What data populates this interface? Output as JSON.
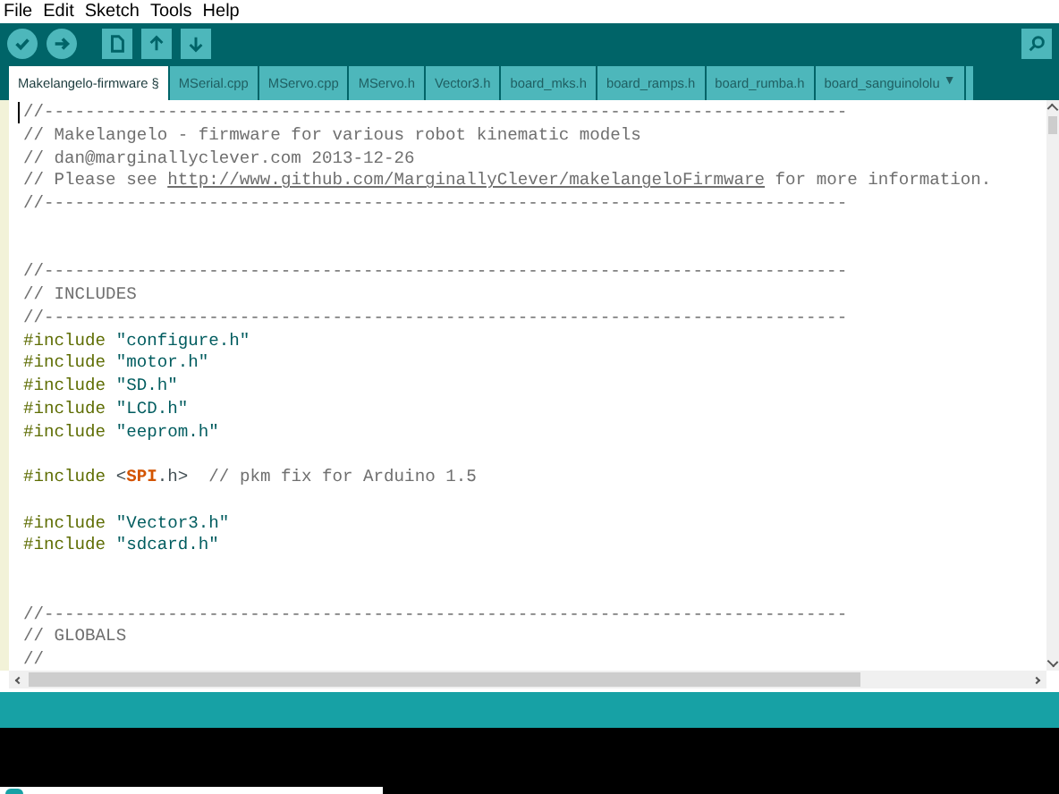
{
  "menu": [
    "File",
    "Edit",
    "Sketch",
    "Tools",
    "Help"
  ],
  "tabs": [
    {
      "label": "Makelangelo-firmware §",
      "selected": true
    },
    {
      "label": "MSerial.cpp",
      "selected": false
    },
    {
      "label": "MServo.cpp",
      "selected": false
    },
    {
      "label": "MServo.h",
      "selected": false
    },
    {
      "label": "Vector3.h",
      "selected": false
    },
    {
      "label": "board_mks.h",
      "selected": false
    },
    {
      "label": "board_ramps.h",
      "selected": false
    },
    {
      "label": "board_rumba.h",
      "selected": false
    },
    {
      "label": "board_sanguinololu",
      "selected": false,
      "menu": "▼"
    }
  ],
  "code": [
    {
      "kind": "comment",
      "text": "//------------------------------------------------------------------------------"
    },
    {
      "kind": "comment",
      "text": "// Makelangelo - firmware for various robot kinematic models"
    },
    {
      "kind": "comment",
      "text": "// dan@marginallyclever.com 2013-12-26"
    },
    {
      "kind": "link",
      "before": "// Please see ",
      "link": "http://www.github.com/MarginallyClever/makelangeloFirmware",
      "after": " for more information."
    },
    {
      "kind": "comment",
      "text": "//------------------------------------------------------------------------------"
    },
    {
      "kind": "blank"
    },
    {
      "kind": "blank"
    },
    {
      "kind": "comment",
      "text": "//------------------------------------------------------------------------------"
    },
    {
      "kind": "comment",
      "text": "// INCLUDES"
    },
    {
      "kind": "comment",
      "text": "//------------------------------------------------------------------------------"
    },
    {
      "kind": "include",
      "directive": "#include",
      "target": "\"configure.h\""
    },
    {
      "kind": "include",
      "directive": "#include",
      "target": "\"motor.h\""
    },
    {
      "kind": "include",
      "directive": "#include",
      "target": "\"SD.h\""
    },
    {
      "kind": "include",
      "directive": "#include",
      "target": "\"LCD.h\""
    },
    {
      "kind": "include",
      "directive": "#include",
      "target": "\"eeprom.h\""
    },
    {
      "kind": "blank"
    },
    {
      "kind": "library",
      "directive": "#include",
      "open": "<",
      "library": "SPI",
      "close": ".h>",
      "comment": "// pkm fix for Arduino 1.5"
    },
    {
      "kind": "blank"
    },
    {
      "kind": "include",
      "directive": "#include",
      "target": "\"Vector3.h\""
    },
    {
      "kind": "include",
      "directive": "#include",
      "target": "\"sdcard.h\""
    },
    {
      "kind": "blank"
    },
    {
      "kind": "blank"
    },
    {
      "kind": "comment",
      "text": "//------------------------------------------------------------------------------"
    },
    {
      "kind": "comment",
      "text": "// GLOBALS"
    },
    {
      "kind": "comment",
      "text": "//"
    }
  ]
}
